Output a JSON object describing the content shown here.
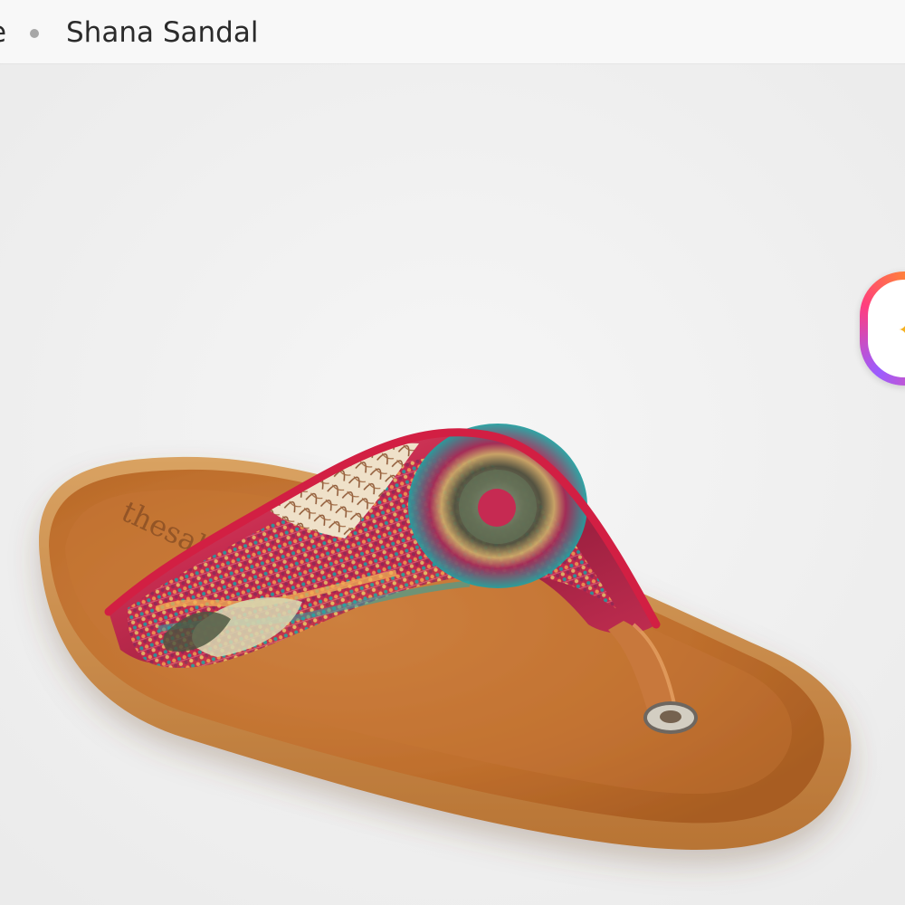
{
  "breadcrumb": {
    "previous": "e",
    "current": "Shana Sandal"
  },
  "product": {
    "name": "Shana Sandal",
    "brand_mark": "thesak",
    "colors": {
      "background": "#efefef",
      "footbed": "#c77a35",
      "strap_primary": "#c6284e",
      "strap_secondary": "#22a1a1"
    }
  },
  "widget": {
    "icon": "sparkle-icon"
  }
}
